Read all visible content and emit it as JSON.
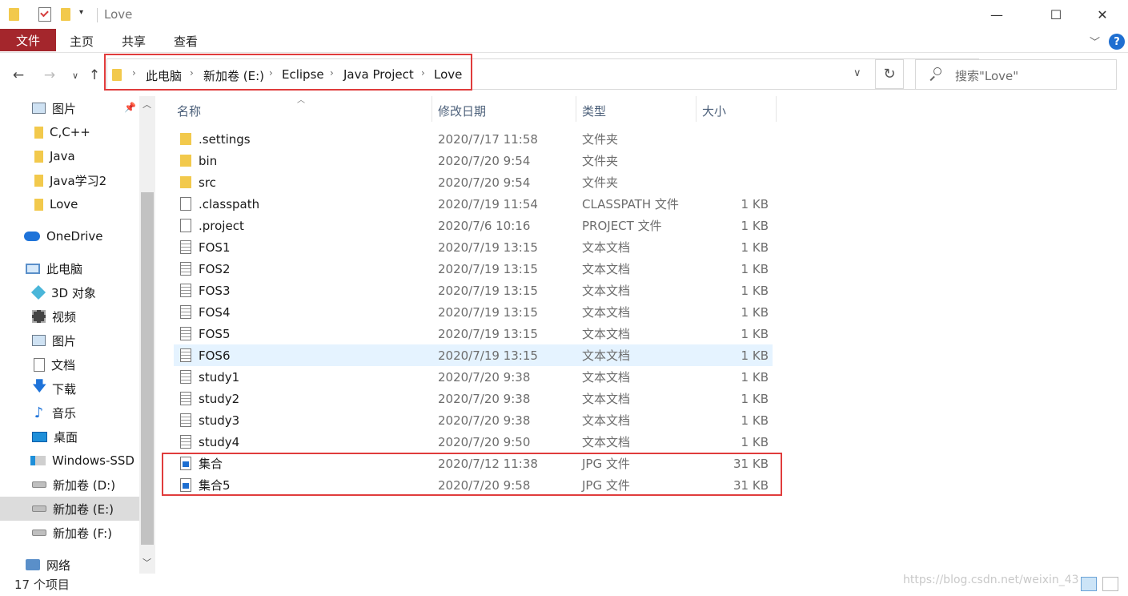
{
  "window": {
    "title": "Love",
    "minimize": "—",
    "maximize": "☐",
    "close": "✕"
  },
  "ribbon": {
    "file": "文件",
    "home": "主页",
    "share": "共享",
    "view": "查看",
    "help": "?"
  },
  "address": {
    "crumbs": [
      "此电脑",
      "新加卷 (E:)",
      "Eclipse",
      "Java Project",
      "Love"
    ],
    "search_placeholder": "搜索\"Love\""
  },
  "sidebar": {
    "items": [
      {
        "label": "图片",
        "icon": "pictures-icon"
      },
      {
        "label": "C,C++",
        "icon": "folder-icon"
      },
      {
        "label": "Java",
        "icon": "folder-icon"
      },
      {
        "label": "Java学习2",
        "icon": "folder-icon"
      },
      {
        "label": "Love",
        "icon": "folder-icon"
      },
      {
        "label": "OneDrive",
        "icon": "cloud-icon"
      },
      {
        "label": "此电脑",
        "icon": "computer-icon"
      },
      {
        "label": "3D 对象",
        "icon": "3d-objects-icon"
      },
      {
        "label": "视频",
        "icon": "video-icon"
      },
      {
        "label": "图片",
        "icon": "pictures-icon"
      },
      {
        "label": "文档",
        "icon": "documents-icon"
      },
      {
        "label": "下载",
        "icon": "download-icon"
      },
      {
        "label": "音乐",
        "icon": "music-icon"
      },
      {
        "label": "桌面",
        "icon": "desktop-icon"
      },
      {
        "label": "Windows-SSD (",
        "icon": "windows-drive-icon"
      },
      {
        "label": "新加卷 (D:)",
        "icon": "drive-icon"
      },
      {
        "label": "新加卷 (E:)",
        "icon": "drive-icon"
      },
      {
        "label": "新加卷 (F:)",
        "icon": "drive-icon"
      },
      {
        "label": "网络",
        "icon": "network-icon"
      }
    ]
  },
  "columns": {
    "name": "名称",
    "date": "修改日期",
    "type": "类型",
    "size": "大小"
  },
  "files": [
    {
      "name": ".settings",
      "date": "2020/7/17 11:58",
      "type": "文件夹",
      "size": "",
      "icon": "folder-icon"
    },
    {
      "name": "bin",
      "date": "2020/7/20 9:54",
      "type": "文件夹",
      "size": "",
      "icon": "folder-icon"
    },
    {
      "name": "src",
      "date": "2020/7/20 9:54",
      "type": "文件夹",
      "size": "",
      "icon": "folder-icon"
    },
    {
      "name": ".classpath",
      "date": "2020/7/19 11:54",
      "type": "CLASSPATH 文件",
      "size": "1 KB",
      "icon": "file-icon"
    },
    {
      "name": ".project",
      "date": "2020/7/6 10:16",
      "type": "PROJECT 文件",
      "size": "1 KB",
      "icon": "file-icon"
    },
    {
      "name": "FOS1",
      "date": "2020/7/19 13:15",
      "type": "文本文档",
      "size": "1 KB",
      "icon": "text-file-icon"
    },
    {
      "name": "FOS2",
      "date": "2020/7/19 13:15",
      "type": "文本文档",
      "size": "1 KB",
      "icon": "text-file-icon"
    },
    {
      "name": "FOS3",
      "date": "2020/7/19 13:15",
      "type": "文本文档",
      "size": "1 KB",
      "icon": "text-file-icon"
    },
    {
      "name": "FOS4",
      "date": "2020/7/19 13:15",
      "type": "文本文档",
      "size": "1 KB",
      "icon": "text-file-icon"
    },
    {
      "name": "FOS5",
      "date": "2020/7/19 13:15",
      "type": "文本文档",
      "size": "1 KB",
      "icon": "text-file-icon"
    },
    {
      "name": "FOS6",
      "date": "2020/7/19 13:15",
      "type": "文本文档",
      "size": "1 KB",
      "icon": "text-file-icon"
    },
    {
      "name": "study1",
      "date": "2020/7/20 9:38",
      "type": "文本文档",
      "size": "1 KB",
      "icon": "text-file-icon"
    },
    {
      "name": "study2",
      "date": "2020/7/20 9:38",
      "type": "文本文档",
      "size": "1 KB",
      "icon": "text-file-icon"
    },
    {
      "name": "study3",
      "date": "2020/7/20 9:38",
      "type": "文本文档",
      "size": "1 KB",
      "icon": "text-file-icon"
    },
    {
      "name": "study4",
      "date": "2020/7/20 9:50",
      "type": "文本文档",
      "size": "1 KB",
      "icon": "text-file-icon"
    },
    {
      "name": "集合",
      "date": "2020/7/12 11:38",
      "type": "JPG 文件",
      "size": "31 KB",
      "icon": "image-file-icon"
    },
    {
      "name": "集合5",
      "date": "2020/7/20 9:58",
      "type": "JPG 文件",
      "size": "31 KB",
      "icon": "image-file-icon"
    }
  ],
  "status": {
    "count": "17 个项目"
  },
  "watermark": "https://blog.csdn.net/weixin_43",
  "colors": {
    "file_tab": "#a4262c",
    "annotation": "#e03c3c",
    "folder": "#f2c94c",
    "hover_row": "#e5f3ff",
    "selected_nav": "#dcdcdc"
  }
}
